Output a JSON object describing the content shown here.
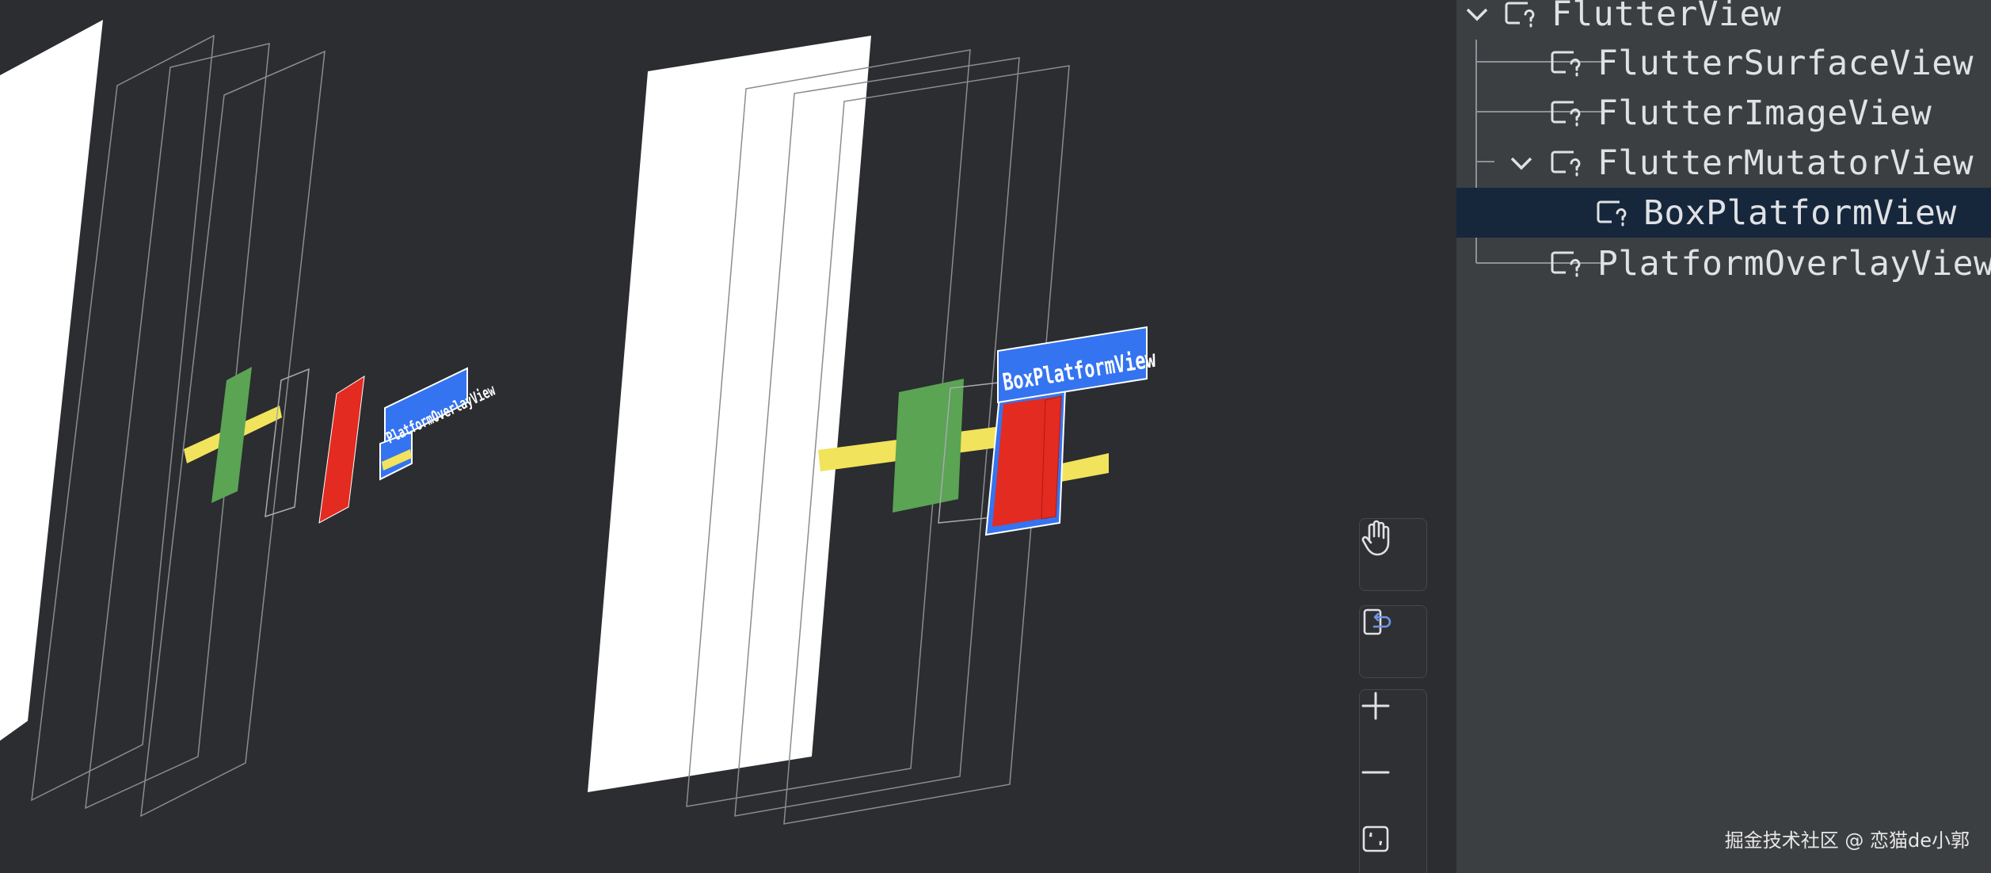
{
  "tree": {
    "items": [
      {
        "label": "FlutterView"
      },
      {
        "label": "FlutterSurfaceView"
      },
      {
        "label": "FlutterImageView"
      },
      {
        "label": "FlutterMutatorView"
      },
      {
        "label": "BoxPlatformView"
      },
      {
        "label": "PlatformOverlayView"
      }
    ],
    "selected": "BoxPlatformView"
  },
  "canvas": {
    "left_view_label": "PlatformOverlayView",
    "right_view_label": "BoxPlatformView"
  },
  "toolbar": {
    "pan_icon": "hand-icon",
    "reset_icon": "reset-view-icon",
    "zoom_in_icon": "plus-icon",
    "zoom_out_icon": "minus-icon",
    "fit_icon": "fit-screen-icon"
  },
  "watermark": "掘金技术社区 @ 恋猫de小郭",
  "colors": {
    "panel_bg": "#3c3f41",
    "canvas_bg": "#2b2d30",
    "selected_row": "#16273c",
    "label_blue": "#3574f0",
    "green": "#5aa454",
    "red": "#e32b21",
    "yellow": "#f2e35c"
  }
}
